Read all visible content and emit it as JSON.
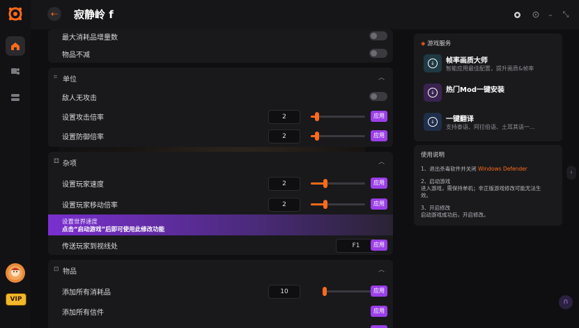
{
  "window": {
    "title": "寂静岭 f"
  },
  "sidebar": {
    "vip_label": "VIP"
  },
  "panel_top": {
    "rows": [
      {
        "label": "最大消耗品增量数"
      },
      {
        "label": "物品不减"
      }
    ]
  },
  "section_unit": {
    "title": "单位",
    "rows": [
      {
        "label": "敌人无攻击"
      },
      {
        "label": "设置攻击倍率",
        "value": "2",
        "apply": "应用",
        "slider_fraction": 0.12
      },
      {
        "label": "设置防御倍率",
        "value": "2",
        "apply": "应用",
        "slider_fraction": 0.12
      }
    ]
  },
  "section_misc": {
    "title": "杂项",
    "rows": [
      {
        "label": "设置玩家速度",
        "value": "2",
        "apply": "应用",
        "slider_fraction": 0.27
      },
      {
        "label": "设置玩家移动倍率",
        "value": "2",
        "apply": "应用",
        "slider_fraction": 0.27
      },
      {
        "label": "传送玩家到视线处",
        "key": "F1",
        "apply": "应用"
      }
    ],
    "tip_title": "设置世界速度",
    "tip_text": "点击“启动游戏”后即可使用此修改功能"
  },
  "section_items": {
    "title": "物品",
    "rows": [
      {
        "label": "添加所有消耗品",
        "value": "10",
        "apply": "应用",
        "slider_fraction": 0.01
      },
      {
        "label": "添加所有信件",
        "apply": "应用"
      }
    ]
  },
  "services": {
    "header": "游戏服务",
    "items": [
      {
        "name": "帧率画质大师",
        "desc": "智能应用最佳配置，提升画质&帧率",
        "color": "#1f3a44"
      },
      {
        "name": "热门Mod一键安装",
        "desc": "",
        "color": "#3a2350"
      },
      {
        "name": "一键翻译",
        "desc": "支持泰语、阿拉伯语、土耳其语一...",
        "color": "#1f2e4a"
      }
    ]
  },
  "instructions": {
    "header": "使用说明",
    "step1_prefix": "1、退出杀毒软件并关闭 ",
    "step1_highlight": "Windows Defender",
    "step2_title": "2、启动游戏",
    "step2_line1": "进入游戏，需保持单机；非正版游戏修改可能无法生",
    "step2_line2": "效。",
    "step3_title": "3、开启修改",
    "step3_line1": "启动游戏成功后，开启修改。"
  },
  "colors": {
    "accent": "#ff6a1a",
    "apply": "#9b3fe8"
  }
}
